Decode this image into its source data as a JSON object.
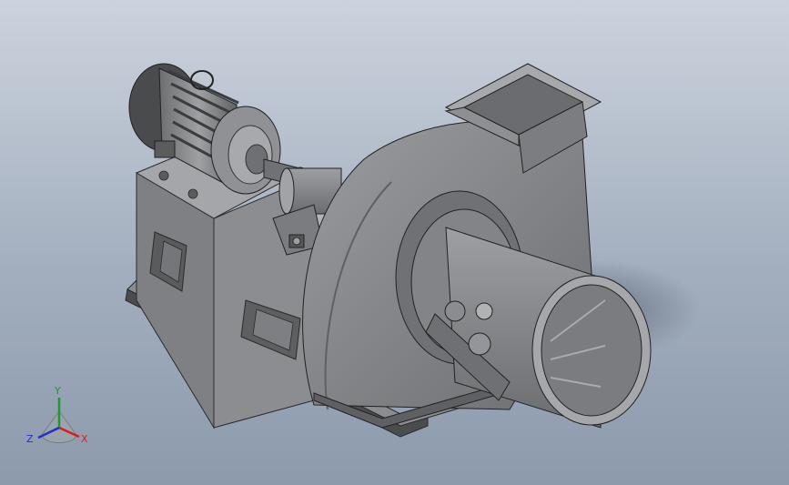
{
  "viewport": {
    "background_top": "#ccd3dd",
    "background_bottom": "#8d9aac"
  },
  "model": {
    "body_color": "#7e8083",
    "dark_color": "#3f4042",
    "light_color": "#a9abae",
    "parts": [
      "motor-icon",
      "coupling-icon",
      "bearing-housing-icon",
      "base-frame-icon",
      "volute-icon",
      "inlet-duct-icon",
      "outlet-flange-icon",
      "damper-arm-icon"
    ]
  },
  "triad": {
    "x_label": "X",
    "y_label": "Y",
    "z_label": "Z",
    "x_color": "#d62020",
    "y_color": "#1c9a2a",
    "z_color": "#2030c8"
  }
}
